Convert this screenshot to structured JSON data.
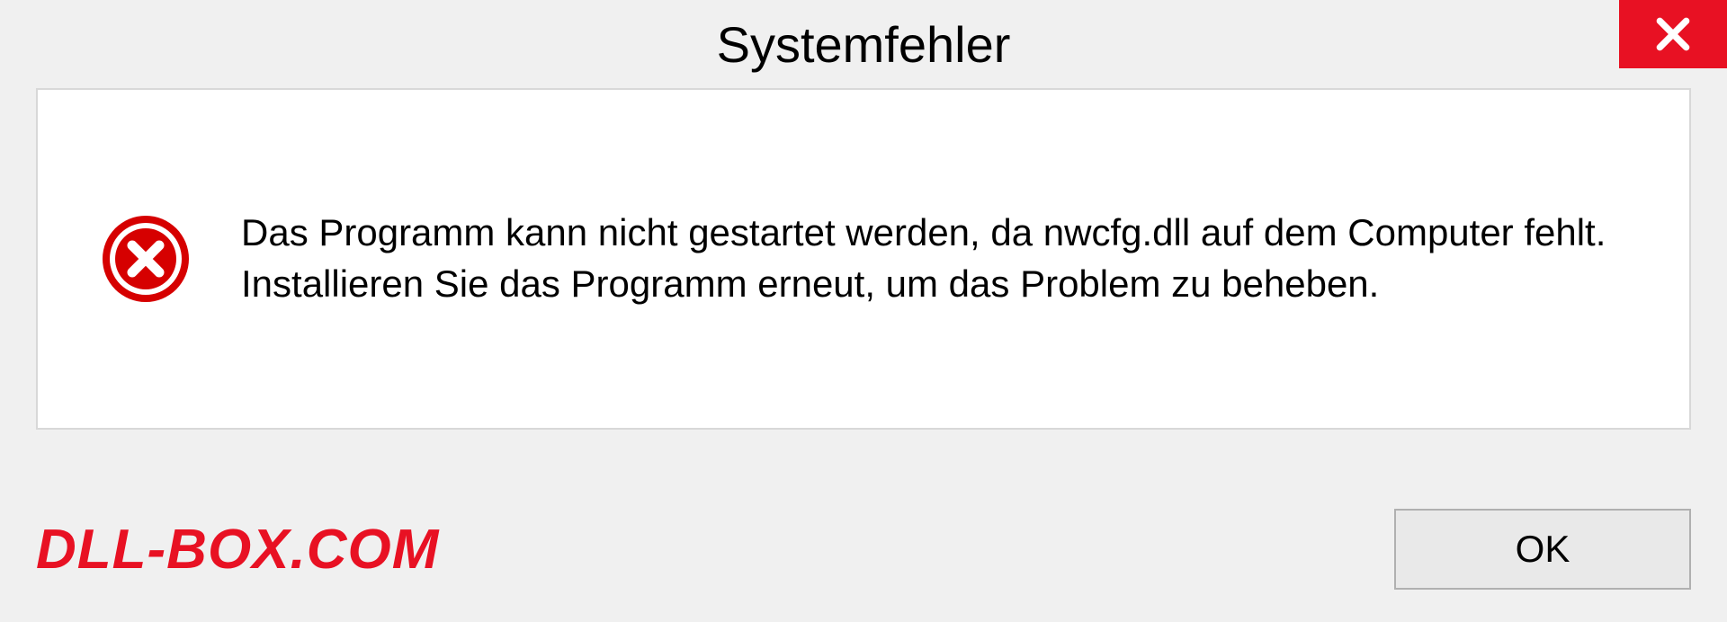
{
  "dialog": {
    "title": "Systemfehler",
    "message": "Das Programm kann nicht gestartet werden, da nwcfg.dll auf dem Computer fehlt. Installieren Sie das Programm erneut, um das Problem zu beheben.",
    "ok_label": "OK"
  },
  "watermark": "DLL-BOX.COM"
}
